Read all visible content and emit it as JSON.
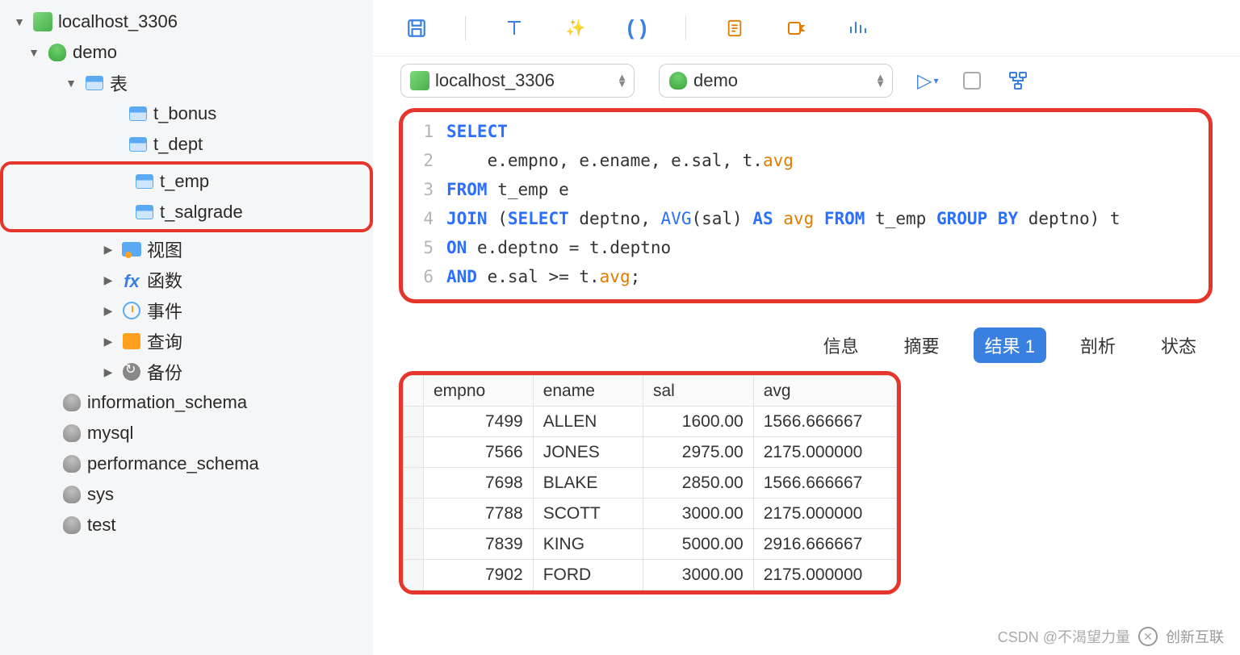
{
  "sidebar": {
    "connection": "localhost_3306",
    "database": "demo",
    "tables_label": "表",
    "tables": [
      "t_bonus",
      "t_dept",
      "t_emp",
      "t_salgrade"
    ],
    "views_label": "视图",
    "functions_label": "函数",
    "events_label": "事件",
    "queries_label": "查询",
    "backup_label": "备份",
    "other_dbs": [
      "information_schema",
      "mysql",
      "performance_schema",
      "sys",
      "test"
    ]
  },
  "selectors": {
    "connection": "localhost_3306",
    "database": "demo"
  },
  "editor": {
    "lines": [
      "1",
      "2",
      "3",
      "4",
      "5",
      "6"
    ],
    "sql_tokens": [
      [
        [
          "kw",
          "SELECT"
        ]
      ],
      [
        [
          "pn",
          "    e.empno, e.ename, e.sal, t."
        ],
        [
          "al",
          "avg"
        ]
      ],
      [
        [
          "kw",
          "FROM"
        ],
        [
          "pn",
          " t_emp e"
        ]
      ],
      [
        [
          "kw",
          "JOIN"
        ],
        [
          "pn",
          " ("
        ],
        [
          "kw",
          "SELECT"
        ],
        [
          "pn",
          " deptno, "
        ],
        [
          "fn",
          "AVG"
        ],
        [
          "pn",
          "(sal) "
        ],
        [
          "kw",
          "AS"
        ],
        [
          "pn",
          " "
        ],
        [
          "al",
          "avg"
        ],
        [
          "pn",
          " "
        ],
        [
          "kw",
          "FROM"
        ],
        [
          "pn",
          " t_emp "
        ],
        [
          "kw",
          "GROUP BY"
        ],
        [
          "pn",
          " deptno) t"
        ]
      ],
      [
        [
          "kw",
          "ON"
        ],
        [
          "pn",
          " e.deptno = t.deptno"
        ]
      ],
      [
        [
          "kw",
          "AND"
        ],
        [
          "pn",
          " e.sal >= t."
        ],
        [
          "al",
          "avg"
        ],
        [
          "pn",
          ";"
        ]
      ]
    ]
  },
  "tabs": {
    "info": "信息",
    "summary": "摘要",
    "result": "结果 1",
    "profiling": "剖析",
    "status": "状态"
  },
  "result": {
    "columns": [
      "empno",
      "ename",
      "sal",
      "avg"
    ],
    "rows": [
      {
        "empno": "7499",
        "ename": "ALLEN",
        "sal": "1600.00",
        "avg": "1566.666667"
      },
      {
        "empno": "7566",
        "ename": "JONES",
        "sal": "2975.00",
        "avg": "2175.000000"
      },
      {
        "empno": "7698",
        "ename": "BLAKE",
        "sal": "2850.00",
        "avg": "1566.666667"
      },
      {
        "empno": "7788",
        "ename": "SCOTT",
        "sal": "3000.00",
        "avg": "2175.000000"
      },
      {
        "empno": "7839",
        "ename": "KING",
        "sal": "5000.00",
        "avg": "2916.666667"
      },
      {
        "empno": "7902",
        "ename": "FORD",
        "sal": "3000.00",
        "avg": "2175.000000"
      }
    ]
  },
  "watermark": {
    "csdn": "CSDN @不渴望力量",
    "brand": "创新互联"
  },
  "chart_data": {
    "type": "table",
    "columns": [
      "empno",
      "ename",
      "sal",
      "avg"
    ],
    "rows": [
      [
        7499,
        "ALLEN",
        1600.0,
        1566.666667
      ],
      [
        7566,
        "JONES",
        2975.0,
        2175.0
      ],
      [
        7698,
        "BLAKE",
        2850.0,
        1566.666667
      ],
      [
        7788,
        "SCOTT",
        3000.0,
        2175.0
      ],
      [
        7839,
        "KING",
        5000.0,
        2916.666667
      ],
      [
        7902,
        "FORD",
        3000.0,
        2175.0
      ]
    ]
  }
}
